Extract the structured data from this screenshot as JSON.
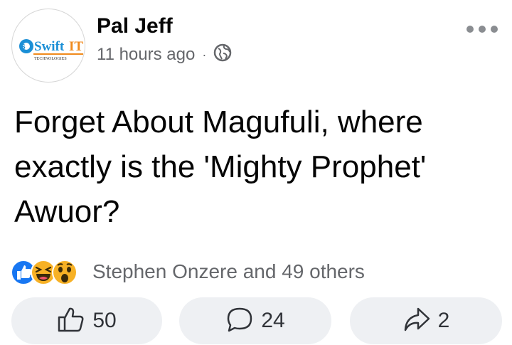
{
  "post": {
    "author": "Pal Jeff",
    "avatar_logo": {
      "brand": "SwiftIT",
      "tagline": "TECHNOLOGIES"
    },
    "time": "11 hours ago",
    "separator": "·",
    "privacy_icon": "globe-icon",
    "more_icon": "more-options-icon",
    "text": "Forget About Magufuli, where\nexactly is the 'Mighty Prophet'\nAwuor?"
  },
  "reactions": {
    "icons": [
      "like-reaction-icon",
      "haha-reaction-icon",
      "wow-reaction-icon"
    ],
    "summary": "Stephen Onzere and 49 others"
  },
  "actions": {
    "like_count": "50",
    "comment_count": "24",
    "share_count": "2"
  },
  "colors": {
    "like_blue": "#1877f2",
    "emoji_yellow": "#f7b125",
    "secondary_text": "#65676b",
    "button_bg": "#eef0f3"
  }
}
